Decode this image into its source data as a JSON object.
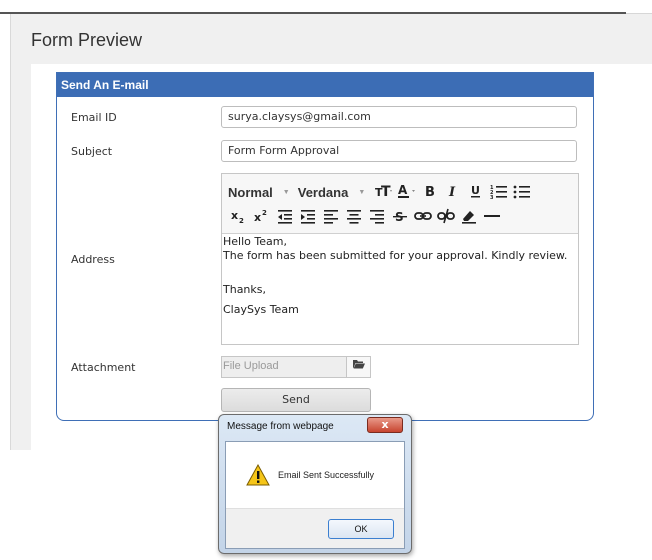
{
  "page": {
    "title": "Form Preview"
  },
  "form": {
    "header": "Send An E-mail",
    "fields": {
      "email": {
        "label": "Email ID",
        "value": "surya.claysys@gmail.com"
      },
      "subject": {
        "label": "Subject",
        "value": "Form Form Approval"
      },
      "address": {
        "label": "Address"
      },
      "attachment": {
        "label": "Attachment",
        "placeholder": "File Upload",
        "button_icon": "folder-open-icon"
      }
    },
    "editor": {
      "format_select": "Normal",
      "font_select": "Verdana",
      "toolbar_row2_icons": [
        "subscript-icon",
        "superscript-icon",
        "outdent-icon",
        "indent-icon",
        "align-left-icon",
        "align-center-icon",
        "align-right-icon",
        "strikethrough-icon",
        "link-icon",
        "unlink-icon",
        "eraser-icon",
        "horizontal-rule-icon"
      ],
      "body": {
        "line1": "Hello Team,",
        "line2": "The form has been submitted for your approval. Kindly review.",
        "line3": "Thanks,",
        "line4": "ClaySys Team"
      }
    },
    "send_label": "Send"
  },
  "dialog": {
    "title": "Message from webpage",
    "close_label": "x",
    "icon": "warning-icon",
    "message": "Email Sent Successfully",
    "ok_label": "OK"
  },
  "colors": {
    "panel_header": "#3c6db5",
    "panel_border": "#3f6fb6",
    "dialog_close": "#c7442f"
  }
}
